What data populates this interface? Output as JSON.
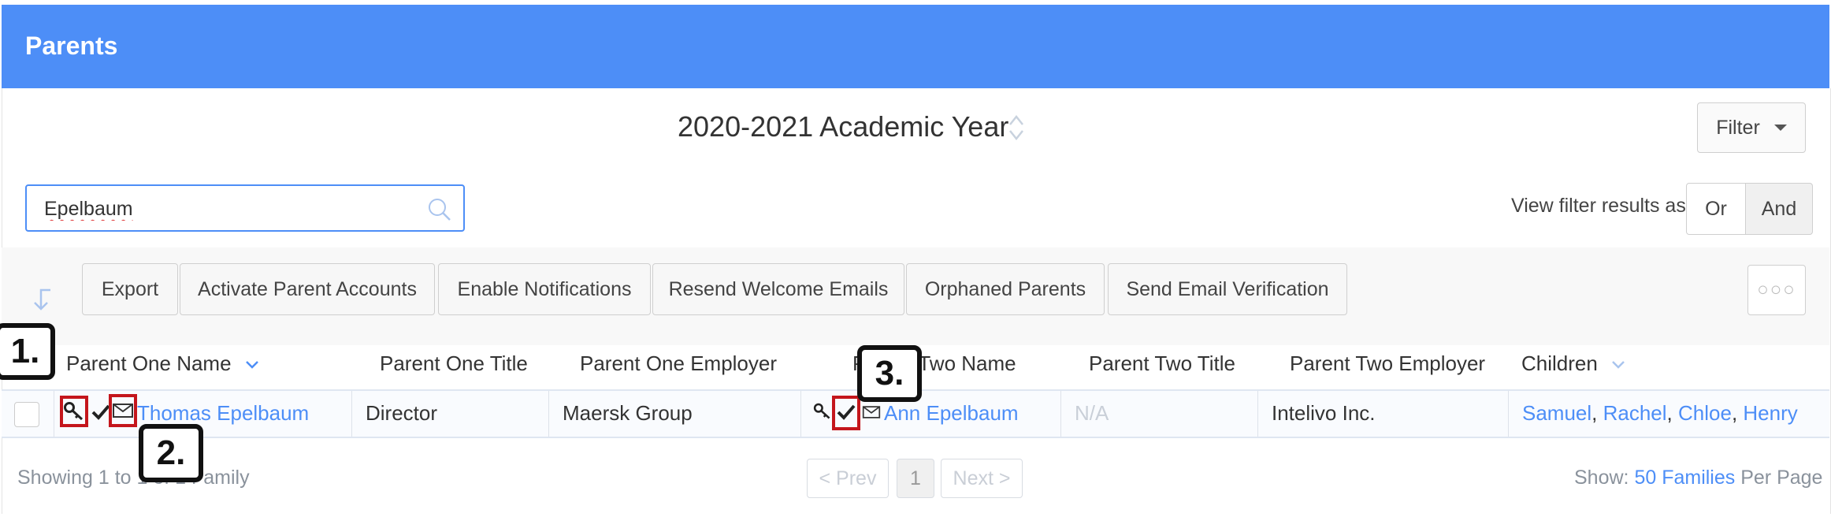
{
  "header": {
    "title": "Parents"
  },
  "academic_year": "2020-2021 Academic Year",
  "filter_button": "Filter",
  "search": {
    "value": "Epelbaum",
    "placeholder": ""
  },
  "view_filter": {
    "label": "View filter results as:",
    "options": [
      "Or",
      "And"
    ],
    "selected": "And"
  },
  "toolbar": {
    "buttons": [
      "Export",
      "Activate Parent Accounts",
      "Enable Notifications",
      "Resend Welcome Emails",
      "Orphaned Parents",
      "Send Email Verification"
    ],
    "more": "○○○"
  },
  "table": {
    "headers": [
      "Parent One Name",
      "Parent One Title",
      "Parent One Employer",
      "Parent Two Name",
      "Parent Two Title",
      "Parent Two Employer",
      "Children"
    ],
    "rows": [
      {
        "parent_one_name": "Thomas Epelbaum",
        "parent_one_title": "Director",
        "parent_one_employer": "Maersk Group",
        "parent_two_name": "Ann Epelbaum",
        "parent_two_title": "N/A",
        "parent_two_employer": "Intelivo Inc.",
        "children": [
          "Samuel",
          "Rachel",
          "Chloe",
          "Henry"
        ]
      }
    ]
  },
  "callouts": [
    "1.",
    "2.",
    "3."
  ],
  "footer": {
    "showing": "Showing 1 to 1 of 1 Family",
    "prev": "< Prev",
    "page": "1",
    "next": "Next >",
    "show_prefix": "Show:",
    "per_page_link": "50 Families",
    "per_page_suffix": "Per Page"
  },
  "colors": {
    "accent": "#4d8ef7",
    "annotation_red": "#c4161c"
  }
}
